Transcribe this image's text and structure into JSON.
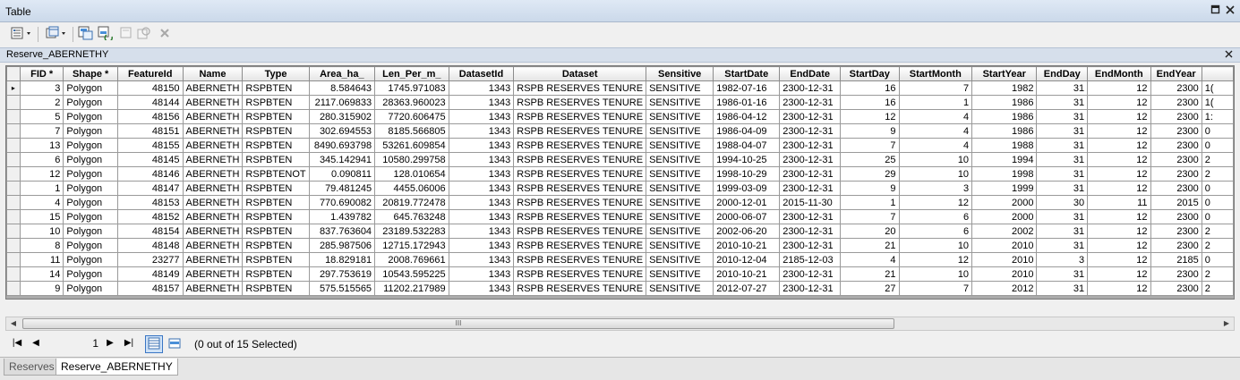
{
  "window": {
    "title": "Table",
    "restore_icon": "restore-icon",
    "close_icon": "close-icon"
  },
  "toolbar": {
    "buttons": [
      "table-options-icon",
      "related-tables-icon",
      "select-by-attributes-icon",
      "switch-selection-icon",
      "clear-selection-icon",
      "zoom-to-selected-icon",
      "delete-selected-icon"
    ]
  },
  "tab": {
    "name": "Reserve_ABERNETHY"
  },
  "grid": {
    "columns": [
      "FID *",
      "Shape *",
      "FeatureId",
      "Name",
      "Type",
      "Area_ha_",
      "Len_Per_m_",
      "DatasetId",
      "Dataset",
      "Sensitive",
      "StartDate",
      "EndDate",
      "StartDay",
      "StartMonth",
      "StartYear",
      "EndDay",
      "EndMonth",
      "EndYear"
    ],
    "rows": [
      [
        "3",
        "Polygon",
        "48150",
        "ABERNETH",
        "RSPBTEN",
        "8.584643",
        "1745.971083",
        "1343",
        "RSPB RESERVES TENURE",
        "SENSITIVE",
        "1982-07-16",
        "2300-12-31",
        "16",
        "7",
        "1982",
        "31",
        "12",
        "2300",
        "1("
      ],
      [
        "2",
        "Polygon",
        "48144",
        "ABERNETH",
        "RSPBTEN",
        "2117.069833",
        "28363.960023",
        "1343",
        "RSPB RESERVES TENURE",
        "SENSITIVE",
        "1986-01-16",
        "2300-12-31",
        "16",
        "1",
        "1986",
        "31",
        "12",
        "2300",
        "1("
      ],
      [
        "5",
        "Polygon",
        "48156",
        "ABERNETH",
        "RSPBTEN",
        "280.315902",
        "7720.606475",
        "1343",
        "RSPB RESERVES TENURE",
        "SENSITIVE",
        "1986-04-12",
        "2300-12-31",
        "12",
        "4",
        "1986",
        "31",
        "12",
        "2300",
        "1:"
      ],
      [
        "7",
        "Polygon",
        "48151",
        "ABERNETH",
        "RSPBTEN",
        "302.694553",
        "8185.566805",
        "1343",
        "RSPB RESERVES TENURE",
        "SENSITIVE",
        "1986-04-09",
        "2300-12-31",
        "9",
        "4",
        "1986",
        "31",
        "12",
        "2300",
        "0"
      ],
      [
        "13",
        "Polygon",
        "48155",
        "ABERNETH",
        "RSPBTEN",
        "8490.693798",
        "53261.609854",
        "1343",
        "RSPB RESERVES TENURE",
        "SENSITIVE",
        "1988-04-07",
        "2300-12-31",
        "7",
        "4",
        "1988",
        "31",
        "12",
        "2300",
        "0"
      ],
      [
        "6",
        "Polygon",
        "48145",
        "ABERNETH",
        "RSPBTEN",
        "345.142941",
        "10580.299758",
        "1343",
        "RSPB RESERVES TENURE",
        "SENSITIVE",
        "1994-10-25",
        "2300-12-31",
        "25",
        "10",
        "1994",
        "31",
        "12",
        "2300",
        "2"
      ],
      [
        "12",
        "Polygon",
        "48146",
        "ABERNETH",
        "RSPBTENOT",
        "0.090811",
        "128.010654",
        "1343",
        "RSPB RESERVES TENURE",
        "SENSITIVE",
        "1998-10-29",
        "2300-12-31",
        "29",
        "10",
        "1998",
        "31",
        "12",
        "2300",
        "2"
      ],
      [
        "1",
        "Polygon",
        "48147",
        "ABERNETH",
        "RSPBTEN",
        "79.481245",
        "4455.06006",
        "1343",
        "RSPB RESERVES TENURE",
        "SENSITIVE",
        "1999-03-09",
        "2300-12-31",
        "9",
        "3",
        "1999",
        "31",
        "12",
        "2300",
        "0"
      ],
      [
        "4",
        "Polygon",
        "48153",
        "ABERNETH",
        "RSPBTEN",
        "770.690082",
        "20819.772478",
        "1343",
        "RSPB RESERVES TENURE",
        "SENSITIVE",
        "2000-12-01",
        "2015-11-30",
        "1",
        "12",
        "2000",
        "30",
        "11",
        "2015",
        "0"
      ],
      [
        "15",
        "Polygon",
        "48152",
        "ABERNETH",
        "RSPBTEN",
        "1.439782",
        "645.763248",
        "1343",
        "RSPB RESERVES TENURE",
        "SENSITIVE",
        "2000-06-07",
        "2300-12-31",
        "7",
        "6",
        "2000",
        "31",
        "12",
        "2300",
        "0"
      ],
      [
        "10",
        "Polygon",
        "48154",
        "ABERNETH",
        "RSPBTEN",
        "837.763604",
        "23189.532283",
        "1343",
        "RSPB RESERVES TENURE",
        "SENSITIVE",
        "2002-06-20",
        "2300-12-31",
        "20",
        "6",
        "2002",
        "31",
        "12",
        "2300",
        "2"
      ],
      [
        "8",
        "Polygon",
        "48148",
        "ABERNETH",
        "RSPBTEN",
        "285.987506",
        "12715.172943",
        "1343",
        "RSPB RESERVES TENURE",
        "SENSITIVE",
        "2010-10-21",
        "2300-12-31",
        "21",
        "10",
        "2010",
        "31",
        "12",
        "2300",
        "2"
      ],
      [
        "11",
        "Polygon",
        "23277",
        "ABERNETH",
        "RSPBTEN",
        "18.829181",
        "2008.769661",
        "1343",
        "RSPB RESERVES TENURE",
        "SENSITIVE",
        "2010-12-04",
        "2185-12-03",
        "4",
        "12",
        "2010",
        "3",
        "12",
        "2185",
        "0"
      ],
      [
        "14",
        "Polygon",
        "48149",
        "ABERNETH",
        "RSPBTEN",
        "297.753619",
        "10543.595225",
        "1343",
        "RSPB RESERVES TENURE",
        "SENSITIVE",
        "2010-10-21",
        "2300-12-31",
        "21",
        "10",
        "2010",
        "31",
        "12",
        "2300",
        "2"
      ],
      [
        "9",
        "Polygon",
        "48157",
        "ABERNETH",
        "RSPBTEN",
        "575.515565",
        "11202.217989",
        "1343",
        "RSPB RESERVES TENURE",
        "SENSITIVE",
        "2012-07-27",
        "2300-12-31",
        "27",
        "7",
        "2012",
        "31",
        "12",
        "2300",
        "2"
      ]
    ],
    "current_row_marker": "▸"
  },
  "scrollbar": {
    "thumb_grip": "III"
  },
  "navigation": {
    "current_record": "1",
    "selection_status": "(0 out of 15 Selected)"
  },
  "bottom_tabs": [
    "Reserves",
    "Reserve_ABERNETHY"
  ]
}
